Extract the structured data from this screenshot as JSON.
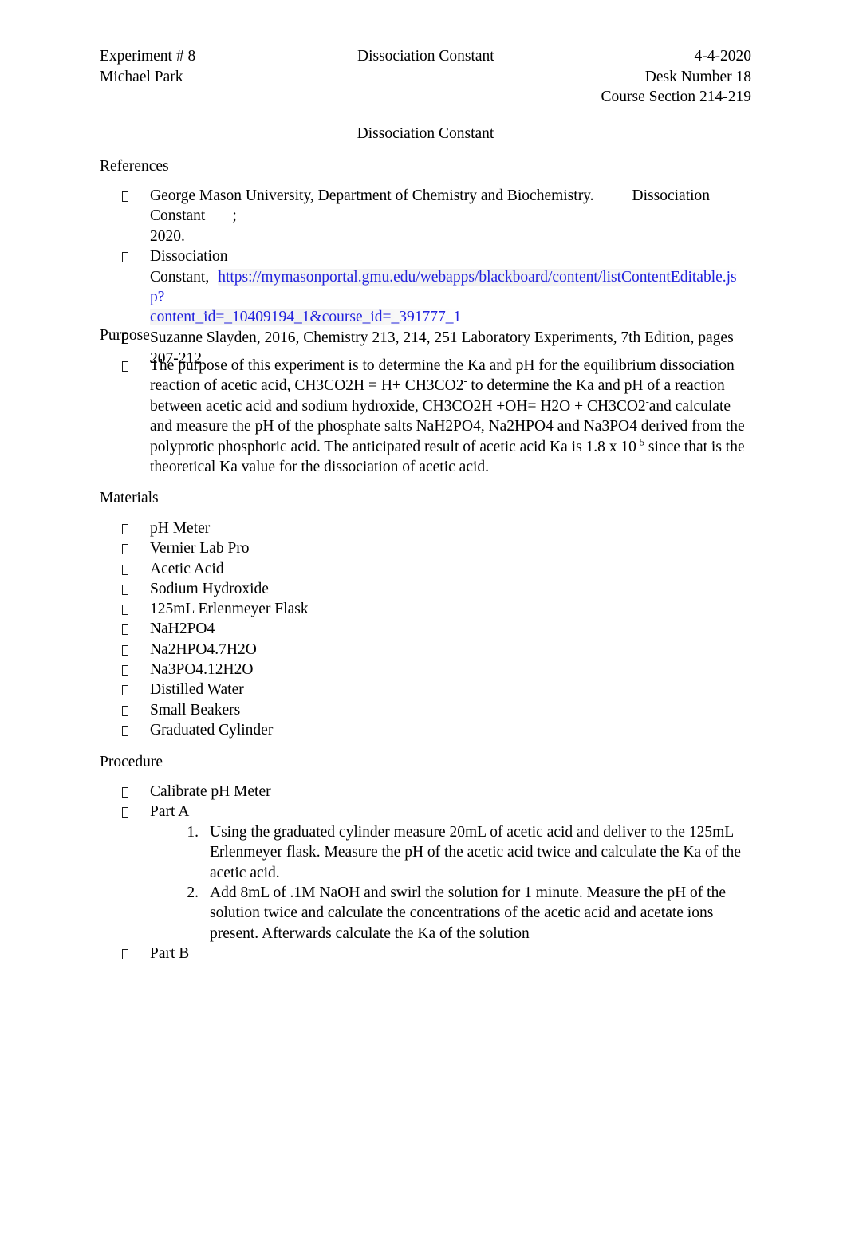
{
  "document": {
    "title": "Dissociation Constant",
    "bullet_glyph": "missing-glyph-box",
    "link_color": "#2020dd",
    "text_color": "#000000",
    "background_color": "#ffffff"
  },
  "header": {
    "experiment": "Experiment # 8",
    "center_title": "Dissociation Constant",
    "date": "4-4-2020",
    "author": "Michael Park",
    "desk_number": "Desk Number 18",
    "course_section": "Course Section 214-219"
  },
  "sections": {
    "references": {
      "heading": "References",
      "items": [
        {
          "part1": "George Mason University, Department of Chemistry and Biochemistry.",
          "part2": "Dissociation Constant",
          "part3": ";",
          "part4": "2020."
        },
        {
          "line1": "Dissociation",
          "line2_prefix": "Constant,",
          "url_line1": "https://mymasonportal.gmu.edu/webapps/blackboard/content/listContentEditable.jsp?",
          "url_line2": "content_id=_10409194_1&course_id=_391777_1"
        },
        {
          "text": "Suzanne Slayden, 2016, Chemistry 213, 214, 251 Laboratory Experiments, 7th Edition, pages 207-212"
        }
      ]
    },
    "purpose": {
      "heading": "Purpose",
      "paragraph_a": "The purpose of this experiment is to determine the Ka and pH for the equilibrium dissociation reaction of acetic acid, CH3CO2H = H+ CH3CO2",
      "sup_minus_1": "-",
      "paragraph_b": " to determine the Ka and pH of a reaction between acetic acid and sodium hydroxide, CH3CO2H +OH= H2O + CH3CO2",
      "sup_minus_2": "-",
      "paragraph_c": "and calculate and measure the pH of the phosphate salts NaH2PO4, Na2HPO4 and Na3PO4 derived from the polyprotic phosphoric acid. The anticipated result of acetic acid Ka is 1.8 x 10",
      "sup_exponent": "-5",
      "paragraph_d": " since that is the theoretical Ka value for the dissociation of acetic acid."
    },
    "materials": {
      "heading": "Materials",
      "items": [
        "pH Meter",
        "Vernier Lab Pro",
        "Acetic Acid",
        "Sodium Hydroxide",
        "125mL Erlenmeyer Flask",
        "NaH2PO4",
        "Na2HPO4.7H2O",
        "Na3PO4.12H2O",
        "Distilled Water",
        "Small Beakers",
        "Graduated Cylinder"
      ]
    },
    "procedure": {
      "heading": "Procedure",
      "items": [
        "Calibrate pH Meter",
        "Part A",
        "Part B"
      ],
      "part_a_steps": [
        {
          "number": "1.",
          "text": "Using the graduated cylinder measure 20mL of acetic acid and deliver to the 125mL Erlenmeyer flask. Measure the pH of the acetic acid twice and calculate the Ka of the acetic acid."
        },
        {
          "number": "2.",
          "text": "Add 8mL of .1M NaOH and swirl the solution for 1 minute. Measure the pH of the solution twice and calculate the concentrations of the acetic acid and acetate ions present. Afterwards calculate the Ka of the solution"
        }
      ]
    }
  }
}
